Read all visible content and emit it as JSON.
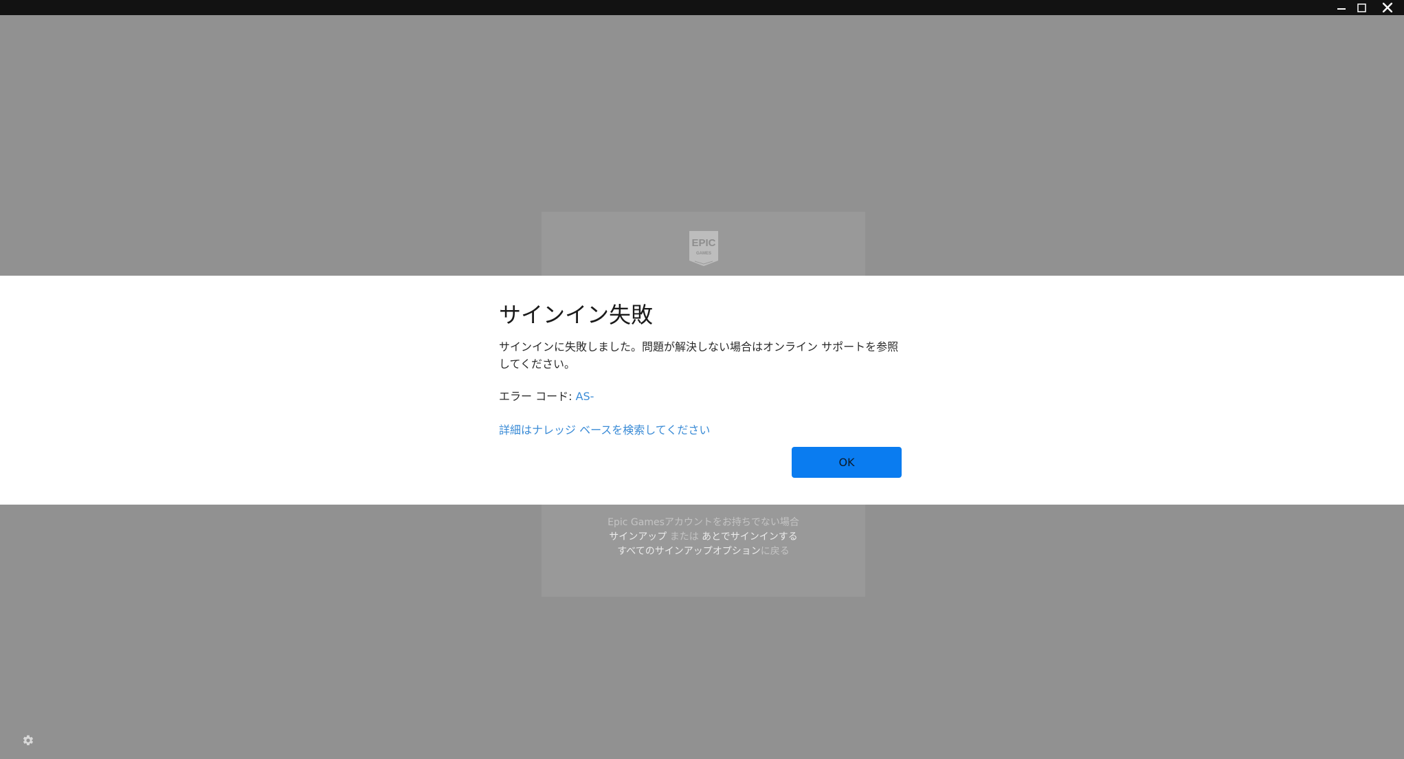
{
  "window": {
    "controls": {
      "minimize_icon": "minimize-icon",
      "maximize_icon": "maximize-icon",
      "close_icon": "close-icon"
    }
  },
  "background": {
    "logo_lines": [
      "EPIC",
      "GAMES"
    ],
    "no_account": "Epic Gamesアカウントをお持ちでない場合",
    "signup": "サインアップ",
    "or": " または ",
    "sign_in_later": "あとでサインインする",
    "all_signup_options": "すべてのサインアップオプション",
    "go_back": "に戻る"
  },
  "dialog": {
    "title": "サインイン失敗",
    "message": "サインインに失敗しました。問題が解決しない場合はオンライン サポートを参照してください。",
    "error_label": "エラー コード: ",
    "error_code": "AS-",
    "kb_link": "詳細はナレッジ ベースを検索してください",
    "ok_label": "OK"
  },
  "colors": {
    "overlay_bg": "#919191",
    "titlebar": "#121212",
    "accent_blue": "#0a7cf0",
    "link_blue": "#3a8bd6"
  }
}
